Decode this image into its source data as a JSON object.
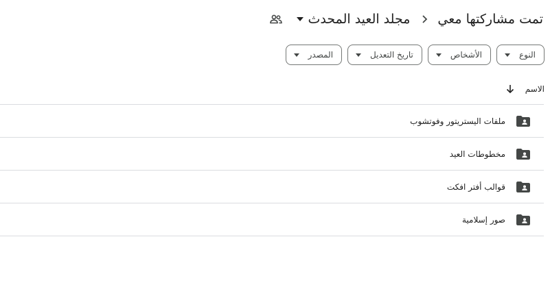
{
  "breadcrumb": {
    "root_label": "تمت مشاركتها معي",
    "current_label": "مجلد العيد المحدث"
  },
  "filters": [
    {
      "label": "النوع"
    },
    {
      "label": "الأشخاص"
    },
    {
      "label": "تاريخ التعديل"
    },
    {
      "label": "المصدر"
    }
  ],
  "column_header": {
    "name_label": "الاسم"
  },
  "files": [
    {
      "name": "ملفات اليستريتور وفوتشوب",
      "icon": "shared-folder-icon"
    },
    {
      "name": "مخطوطات العيد",
      "icon": "shared-folder-icon"
    },
    {
      "name": "قوالب أفتر افكت",
      "icon": "shared-folder-icon"
    },
    {
      "name": "صور إسلامية",
      "icon": "shared-folder-icon"
    }
  ],
  "colors": {
    "icon": "#444746",
    "text": "#1f1f1f",
    "divider": "#dadce0",
    "chip_border": "#747775"
  }
}
